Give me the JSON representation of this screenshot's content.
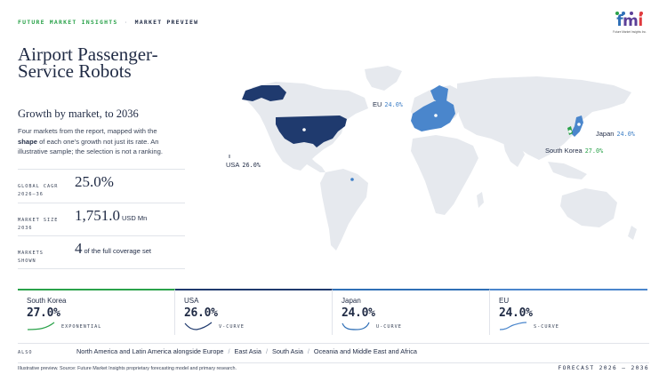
{
  "header": {
    "brand": "FUTURE MARKET INSIGHTS",
    "separator": "·",
    "section": "MARKET PREVIEW"
  },
  "logo": {
    "word": [
      "f",
      "m",
      "i"
    ],
    "tagline": "Future Market Insights Inc.",
    "colors": [
      "#2f6fb6",
      "#5b3f98",
      "#e03a3e",
      "#2aa24a"
    ]
  },
  "report": {
    "title": "Airport Passenger-Service Robots",
    "subtitle": "Growth by market, to 2036",
    "description_pre": "Four markets from the report, mapped with the ",
    "description_bold": "shape",
    "description_post": " of each one's growth not just its rate. An illustrative sample; the selection is not a ranking."
  },
  "stats": {
    "cagr": {
      "label_line1": "GLOBAL CAGR",
      "label_line2": "2026–36",
      "value": "25.0%"
    },
    "size": {
      "label_line1": "MARKET SIZE",
      "label_line2": "2036",
      "value": "1,751.0",
      "unit": "USD Mn"
    },
    "markets": {
      "label_line1": "MARKETS",
      "label_line2": "SHOWN",
      "value": "4",
      "text": "of the full coverage set"
    }
  },
  "map": {
    "labels": {
      "eu": {
        "name": "EU",
        "pct": "24.0%"
      },
      "japan": {
        "name": "Japan",
        "pct": "24.0%"
      },
      "south_korea": {
        "name": "South Korea",
        "pct": "27.0%"
      },
      "usa": {
        "name": "USA",
        "pct": "26.0%"
      }
    },
    "colors": {
      "land": "#e6e9ee",
      "usa": "#1f3a6e",
      "eu": "#4a86cc",
      "japan": "#4a86cc",
      "korea": "#2aa24a"
    }
  },
  "cards": [
    {
      "name": "South Korea",
      "value": "27.0%",
      "curve": "EXPONENTIAL",
      "color": "#2aa24a"
    },
    {
      "name": "USA",
      "value": "26.0%",
      "curve": "V-CURVE",
      "color": "#1f3a6e"
    },
    {
      "name": "Japan",
      "value": "24.0%",
      "curve": "U-CURVE",
      "color": "#2f6fb6"
    },
    {
      "name": "EU",
      "value": "24.0%",
      "curve": "S-CURVE",
      "color": "#4a86cc"
    }
  ],
  "also": {
    "label": "ALSO",
    "items": [
      "North America and Latin America alongside Europe",
      "East Asia",
      "South Asia",
      "Oceania and Middle East and Africa"
    ]
  },
  "footer": {
    "source": "Illustrative preview. Source: Future Market Insights proprietary forecasting model and primary research.",
    "forecast": "FORECAST 2026 – 2036"
  }
}
